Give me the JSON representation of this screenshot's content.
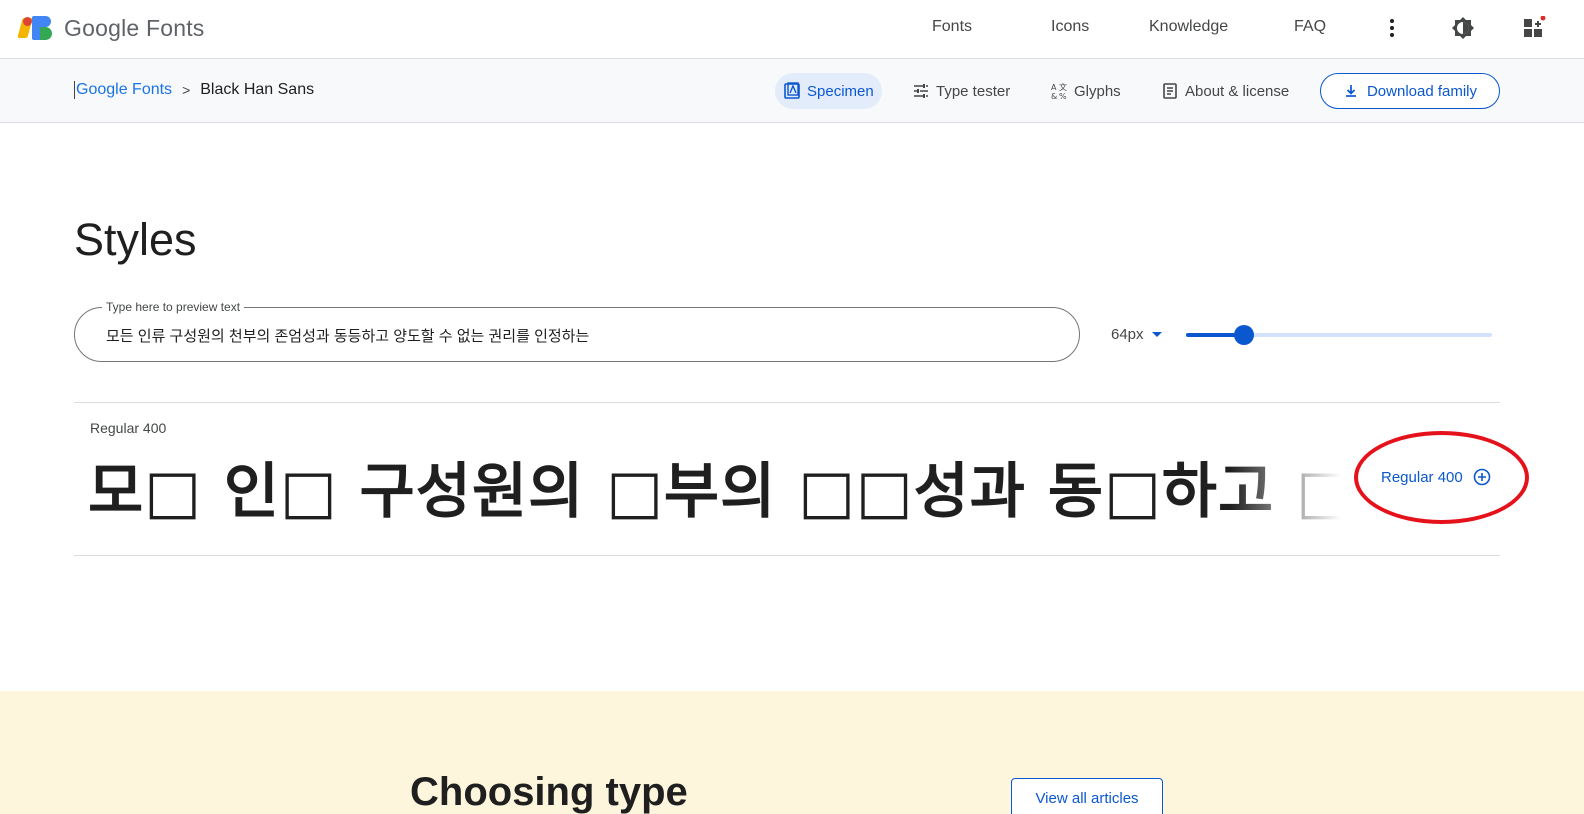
{
  "header": {
    "logo_text": "Google Fonts",
    "nav": [
      "Fonts",
      "Icons",
      "Knowledge",
      "FAQ"
    ],
    "icons": [
      "more-vert-icon",
      "theme-toggle-icon",
      "apps-grid-icon"
    ]
  },
  "subnav": {
    "breadcrumb_root": "Google Fonts",
    "breadcrumb_sep": ">",
    "breadcrumb_current": "Black Han Sans",
    "tabs": {
      "specimen": "Specimen",
      "type_tester": "Type tester",
      "glyphs": "Glyphs",
      "about": "About & license"
    },
    "active_tab": "specimen",
    "download_label": "Download family"
  },
  "styles": {
    "title": "Styles",
    "preview_label": "Type here to preview text",
    "preview_text": "모든 인류 구성원의 천부의 존엄성과 동등하고 양도할 수 없는 권리를 인정하는",
    "size_label": "64px",
    "slider_value_fraction": 0.19,
    "style_name": "Regular 400",
    "specimen_text": "모□ 인□ 구성원의 □부의 □□성과 동□하고 □도□",
    "select_label": "Regular 400"
  },
  "articles": {
    "heading": "Choosing type",
    "view_all_label": "View all articles"
  },
  "colors": {
    "accent": "#0b57d0",
    "annotation_circle": "#e5121b",
    "band": "#fdf6dd"
  }
}
